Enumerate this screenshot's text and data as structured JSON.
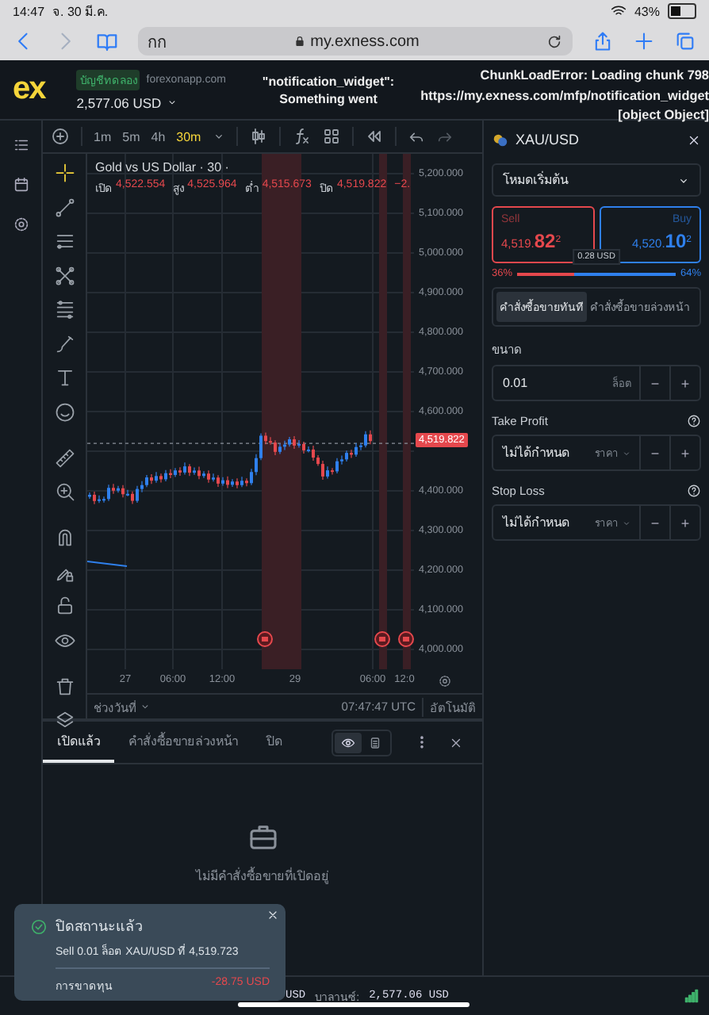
{
  "device_status": {
    "time": "14:47",
    "date": "จ. 30 มี.ค.",
    "battery": "43%"
  },
  "browser": {
    "text_size": "กก",
    "url": "my.exness.com"
  },
  "header": {
    "logo": "ex",
    "account_badge": "บัญชีทดลอง",
    "server": "forexonapp.com",
    "balance": "2,577.06 USD",
    "error_center": [
      "\"notification_widget\":",
      "Something went"
    ],
    "error_right": [
      "ChunkLoadError: Loading chunk 798",
      "https://my.exness.com/mfp/notification_widget",
      "[object Object]"
    ]
  },
  "chart": {
    "timeframes": [
      {
        "label": "1m",
        "selected": false
      },
      {
        "label": "5m",
        "selected": false
      },
      {
        "label": "4h",
        "selected": false
      },
      {
        "label": "30m",
        "selected": true
      }
    ],
    "title": "Gold vs US Dollar · 30 ·",
    "ohlc": [
      {
        "label": "เปิด",
        "value": "4,522.554"
      },
      {
        "label": "สูง",
        "value": "4,525.964"
      },
      {
        "label": "ต่ำ",
        "value": "4,515.673"
      },
      {
        "label": "ปิด",
        "value": "4,519.822"
      }
    ],
    "change": "−2.",
    "y_labels": [
      "5,200.000",
      "5,100.000",
      "5,000.000",
      "4,900.000",
      "4,800.000",
      "4,700.000",
      "4,600.000",
      "4,400.000",
      "4,300.000",
      "4,200.000",
      "4,100.000",
      "4,000.000"
    ],
    "price_tag": "4,519.822",
    "x_labels": [
      "27",
      "06:00",
      "12:00",
      "29",
      "06:00",
      "12:0"
    ],
    "range_button": "ช่วงวันที่",
    "clock": "07:47:47 UTC",
    "scale_mode": "อัตโนมัติ"
  },
  "order_panel": {
    "symbol": "XAU/USD",
    "mode": "โหมดเริ่มต้น",
    "sell": {
      "label": "Sell",
      "price": "4,519.**82**$^{2}$"
    },
    "buy": {
      "label": "Buy",
      "price": "4,520.**10**$^{2}$"
    },
    "spread": "0.28 USD",
    "sell_share": "36%",
    "buy_share": "64%",
    "sentiment": {
      "level": 0.36
    },
    "order_types": [
      {
        "label": "คำสั่งซื้อขายทันที",
        "selected": true
      },
      {
        "label": "คำสั่งซื้อขายล่วงหน้า",
        "selected": false
      }
    ],
    "volume": {
      "label": "ขนาด",
      "value": "0.01",
      "unit": "ล็อต"
    },
    "take_profit": {
      "label": "Take Profit",
      "value": "ไม่ได้กำหนด",
      "unit": "ราคา"
    },
    "stop_loss": {
      "label": "Stop Loss",
      "value": "ไม่ได้กำหนด",
      "unit": "ราคา"
    },
    "minus": "−",
    "plus": "+"
  },
  "positions": {
    "tabs": [
      {
        "label": "เปิดแล้ว",
        "selected": true
      },
      {
        "label": "คำสั่งซื้อขายล่วงหน้า",
        "selected": false
      },
      {
        "label": "ปิด",
        "selected": false
      }
    ],
    "view_modes": [
      {
        "selected": true
      },
      {
        "selected": false
      }
    ],
    "empty_message": "ไม่มีคำสั่งซื้อขายที่เปิดอยู่"
  },
  "footer": {
    "partial": "USD",
    "balance_label": "บาลานซ์:",
    "balance_value": "2,577.06 USD"
  },
  "toast": {
    "title": "ปิดสถานะแล้ว",
    "detail": "Sell 0.01 ล็อต XAU/USD ที่ 4,519.723",
    "result_label": "การขาดทุน",
    "result_value": "-28.75 USD"
  }
}
